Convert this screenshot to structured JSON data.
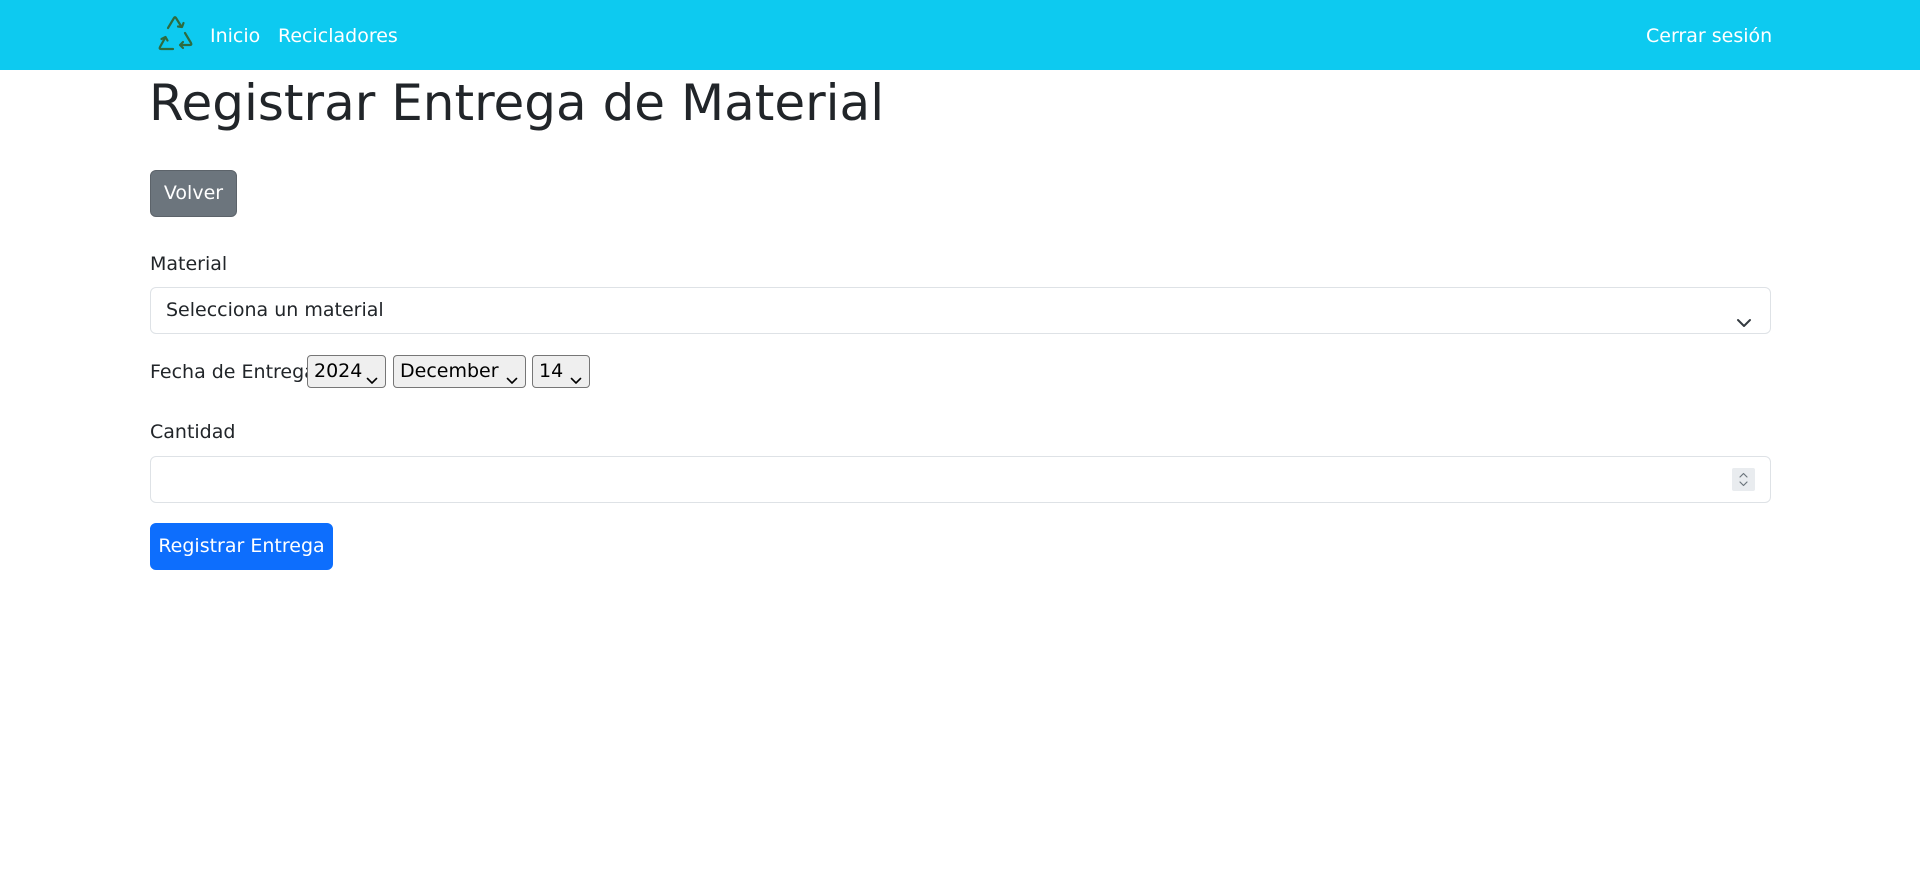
{
  "nav": {
    "logo_icon": "recycle-icon",
    "items": [
      {
        "label": "Inicio"
      },
      {
        "label": "Recicladores"
      }
    ],
    "logout_label": "Cerrar sesión",
    "background_color": "#0dcaf0"
  },
  "page": {
    "title": "Registrar Entrega de Material"
  },
  "buttons": {
    "back_label": "Volver",
    "back_color": "#6c757d",
    "submit_label": "Registrar Entrega",
    "submit_color": "#0d6efd"
  },
  "form": {
    "material_label": "Material",
    "material_selected": "Selecciona un material",
    "date_label": "Fecha de Entrega",
    "date_year": "2024",
    "date_month": "December",
    "date_day": "14",
    "quantity_label": "Cantidad",
    "quantity_value": ""
  }
}
